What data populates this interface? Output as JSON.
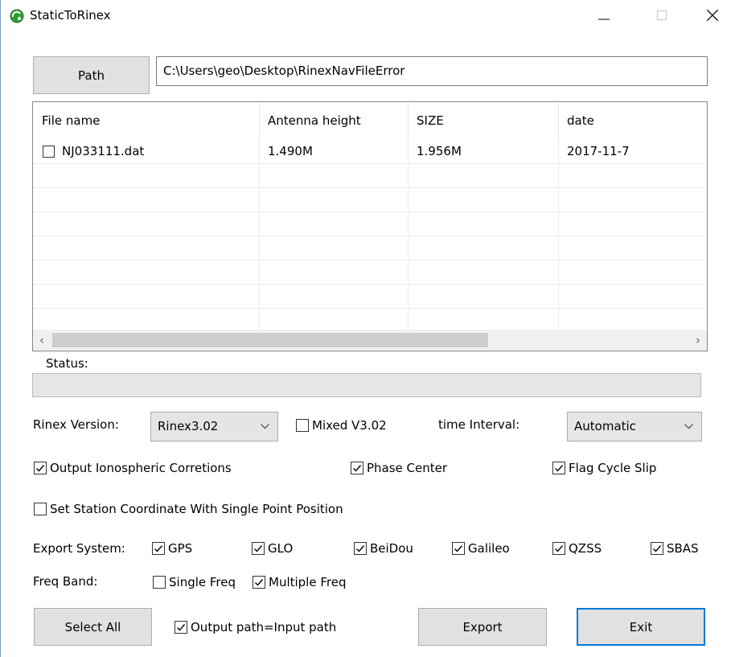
{
  "window": {
    "title": "StaticToRinex"
  },
  "path": {
    "button_label": "Path",
    "value": "C:\\Users\\geo\\Desktop\\RinexNavFileError"
  },
  "table": {
    "columns": [
      "File name",
      "Antenna height",
      "SIZE",
      "date"
    ],
    "rows": [
      {
        "checked": false,
        "file_name": "NJ033111.dat",
        "antenna_height": "1.490M",
        "size": "1.956M",
        "date": "2017-11-7"
      }
    ]
  },
  "status": {
    "label": "Status:",
    "progress": 0
  },
  "rinex": {
    "label": "Rinex Version:",
    "value": "Rinex3.02"
  },
  "mixed": {
    "label": "Mixed V3.02",
    "checked": false
  },
  "interval": {
    "label": "time Interval:",
    "value": "Automatic"
  },
  "options": {
    "iono": {
      "label": "Output Ionospheric Corretions",
      "checked": true
    },
    "phase": {
      "label": "Phase Center",
      "checked": true
    },
    "slip": {
      "label": "Flag Cycle Slip",
      "checked": true
    },
    "station": {
      "label": "Set Station Coordinate With Single Point Position",
      "checked": false
    }
  },
  "export_system": {
    "label": "Export System:",
    "gps": {
      "label": "GPS",
      "checked": true
    },
    "glo": {
      "label": "GLO",
      "checked": true
    },
    "beidou": {
      "label": "BeiDou",
      "checked": true
    },
    "galileo": {
      "label": "Galileo",
      "checked": true
    },
    "qzss": {
      "label": "QZSS",
      "checked": true
    },
    "sbas": {
      "label": "SBAS",
      "checked": true
    }
  },
  "freq_band": {
    "label": "Freq Band:",
    "single": {
      "label": "Single Freq",
      "checked": false
    },
    "multiple": {
      "label": "Multiple Freq",
      "checked": true
    }
  },
  "output_path": {
    "label": "Output path=Input path",
    "checked": true
  },
  "buttons": {
    "select_all": "Select All",
    "export": "Export",
    "exit": "Exit"
  },
  "colors": {
    "accent": "#0078d7",
    "button_face": "#e1e1e1",
    "progress_green": "#06b025"
  }
}
